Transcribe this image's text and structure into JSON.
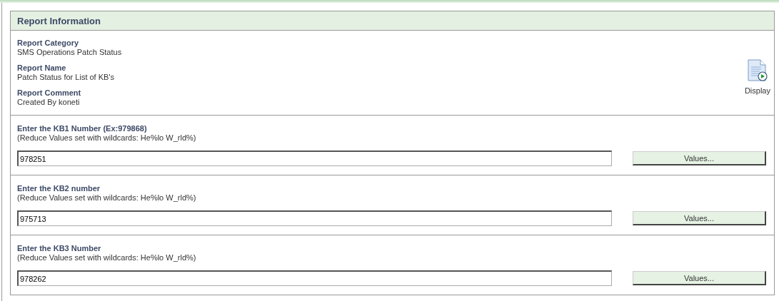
{
  "panel": {
    "title": "Report Information"
  },
  "info": [
    {
      "label": "Report Category",
      "value": "SMS Operations Patch Status"
    },
    {
      "label": "Report Name",
      "value": "Patch Status for List of KB's"
    },
    {
      "label": "Report Comment",
      "value": "Created By koneti"
    }
  ],
  "display_button": {
    "label": "Display"
  },
  "parameters": [
    {
      "label": "Enter the KB1 Number (Ex:979868)",
      "hint": "(Reduce Values set with wildcards: He%lo W_rld%)",
      "value": "978251",
      "button": "Values..."
    },
    {
      "label": "Enter the KB2 number",
      "hint": "(Reduce Values set with wildcards: He%lo W_rld%)",
      "value": "975713",
      "button": "Values..."
    },
    {
      "label": "Enter the KB3 Number",
      "hint": "(Reduce Values set with wildcards: He%lo W_rld%)",
      "value": "978262",
      "button": "Values..."
    }
  ]
}
